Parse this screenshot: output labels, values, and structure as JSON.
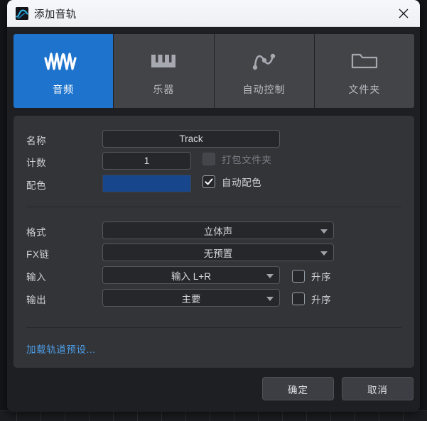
{
  "window": {
    "title": "添加音轨",
    "icon": "waveform-app-icon",
    "close_icon": "close-icon"
  },
  "tabs": [
    {
      "label": "音频",
      "icon": "audio-waveform-icon",
      "active": true
    },
    {
      "label": "乐器",
      "icon": "piano-keys-icon",
      "active": false
    },
    {
      "label": "自动控制",
      "icon": "automation-curve-icon",
      "active": false
    },
    {
      "label": "文件夹",
      "icon": "folder-icon",
      "active": false
    }
  ],
  "form": {
    "name": {
      "label": "名称",
      "value": "Track"
    },
    "count": {
      "label": "计数",
      "value": "1"
    },
    "pack_folder": {
      "label": "打包文件夹",
      "checked": false,
      "disabled": true
    },
    "color": {
      "label": "配色",
      "value": "#17468c"
    },
    "auto_color": {
      "label": "自动配色",
      "checked": true,
      "check_glyph": "✓"
    },
    "format": {
      "label": "格式",
      "value": "立体声"
    },
    "fx_chain": {
      "label": "FX链",
      "value": "无预置"
    },
    "input": {
      "label": "输入",
      "value": "输入 L+R"
    },
    "input_ascending": {
      "label": "升序",
      "checked": false
    },
    "output": {
      "label": "输出",
      "value": "主要"
    },
    "output_ascending": {
      "label": "升序",
      "checked": false
    },
    "load_preset_link": "加载轨道预设..."
  },
  "footer": {
    "ok_label": "确定",
    "cancel_label": "取消"
  },
  "colors": {
    "accent_blue": "#1e74cd",
    "link_blue": "#4d9de6",
    "track_color": "#17468c",
    "panel_bg": "#323438",
    "dialog_bg": "#1e1f22"
  }
}
